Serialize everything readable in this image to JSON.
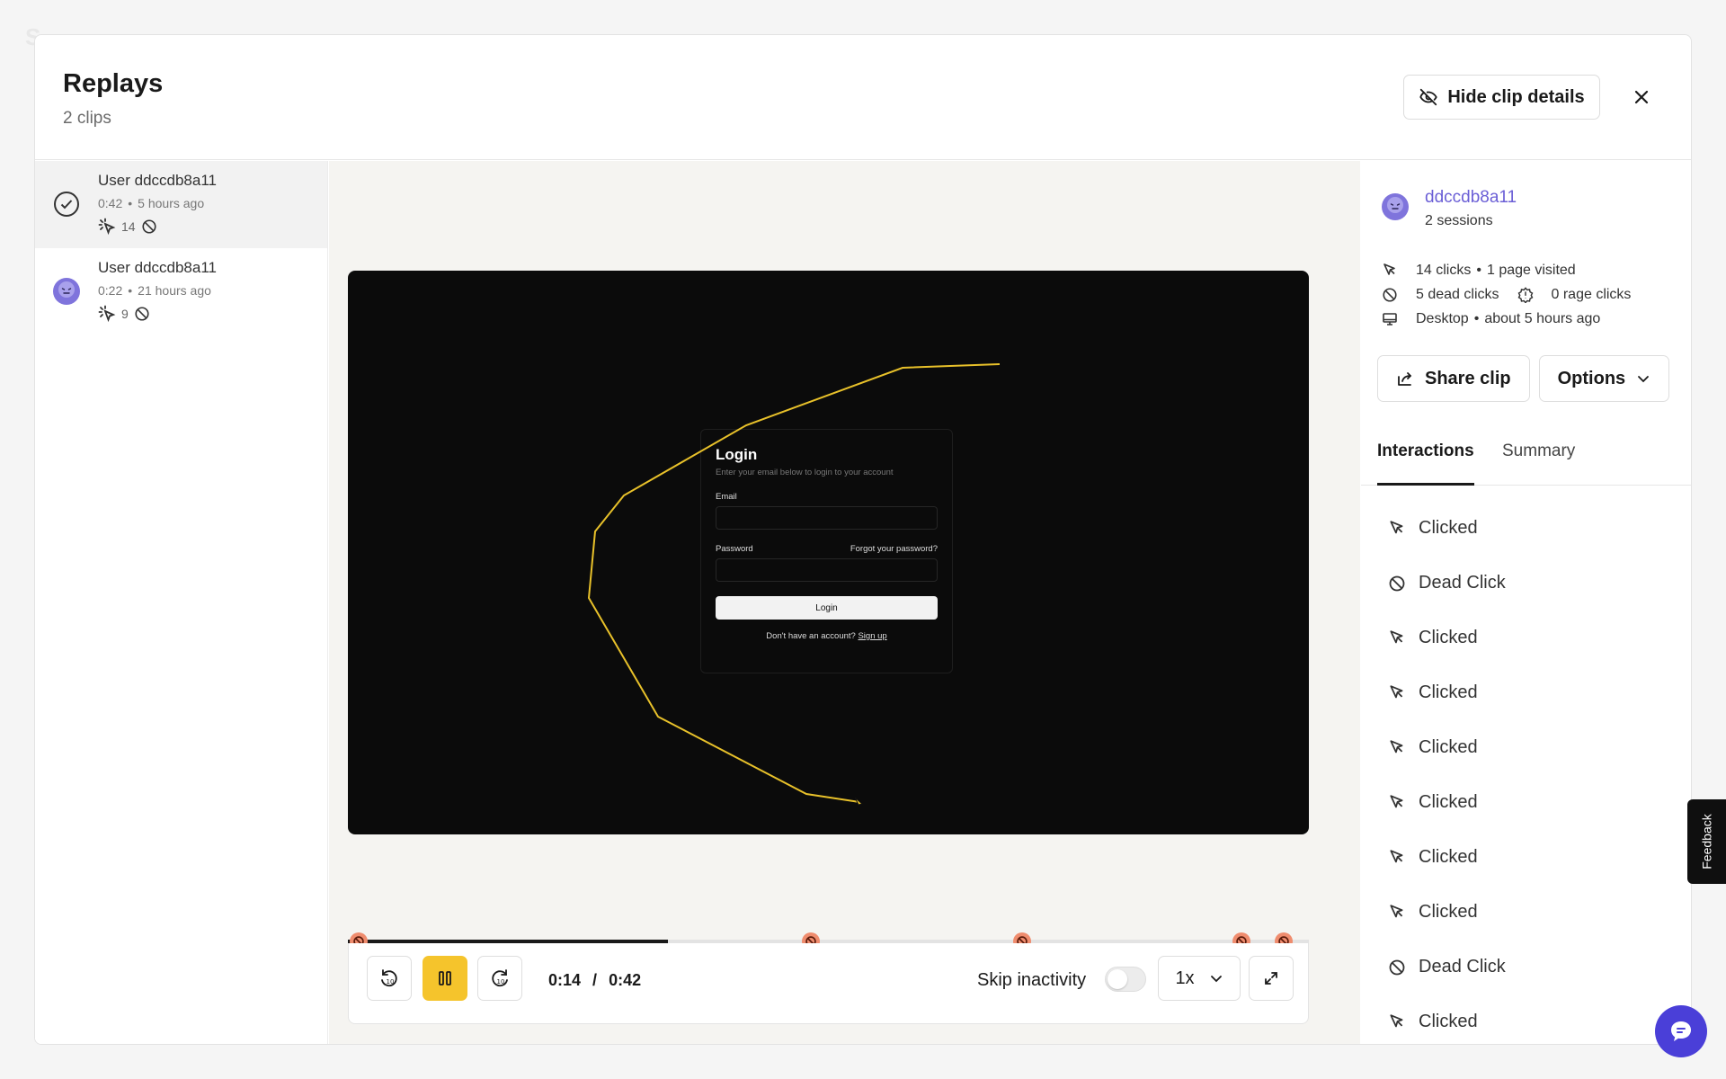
{
  "header": {
    "title": "Replays",
    "subtitle": "2 clips",
    "hide_details_label": "Hide clip details"
  },
  "clips": [
    {
      "user": "User ddccdb8a11",
      "duration": "0:42",
      "age": "5 hours ago",
      "clicks": "14",
      "selected": true
    },
    {
      "user": "User ddccdb8a11",
      "duration": "0:22",
      "age": "21 hours ago",
      "clicks": "9",
      "selected": false
    }
  ],
  "video": {
    "login": {
      "title": "Login",
      "subtitle": "Enter your email below to login to your account",
      "email_label": "Email",
      "password_label": "Password",
      "forgot_label": "Forgot your password?",
      "button_label": "Login",
      "footer_text": "Don't have an account?",
      "signup_label": "Sign up"
    }
  },
  "player": {
    "current_time": "0:14",
    "separator": "/",
    "total_time": "0:42",
    "progress": 0.333,
    "skip_inactivity_label": "Skip inactivity",
    "skip_inactivity_on": false,
    "speed": "1x",
    "rewind_label": "10",
    "forward_label": "10"
  },
  "details": {
    "username": "ddccdb8a11",
    "sessions": "2 sessions",
    "clicks": "14 clicks",
    "pages": "1 page visited",
    "dead_clicks": "5 dead clicks",
    "rage_clicks": "0 rage clicks",
    "device": "Desktop",
    "time_ago": "about 5 hours ago",
    "dot": "•",
    "share_label": "Share clip",
    "options_label": "Options",
    "tabs": [
      {
        "label": "Interactions",
        "active": true
      },
      {
        "label": "Summary",
        "active": false
      }
    ],
    "events": [
      {
        "type": "click",
        "label": "Clicked"
      },
      {
        "type": "dead",
        "label": "Dead Click"
      },
      {
        "type": "click",
        "label": "Clicked"
      },
      {
        "type": "click",
        "label": "Clicked"
      },
      {
        "type": "click",
        "label": "Clicked"
      },
      {
        "type": "click",
        "label": "Clicked"
      },
      {
        "type": "click",
        "label": "Clicked"
      },
      {
        "type": "click",
        "label": "Clicked"
      },
      {
        "type": "dead",
        "label": "Dead Click"
      },
      {
        "type": "click",
        "label": "Clicked"
      }
    ]
  },
  "feedback_label": "Feedback",
  "colors": {
    "accent_yellow": "#f5c42c",
    "marker": "#ef8c6e",
    "link_purple": "#6b5fd6",
    "chat": "#4a3fd8"
  }
}
